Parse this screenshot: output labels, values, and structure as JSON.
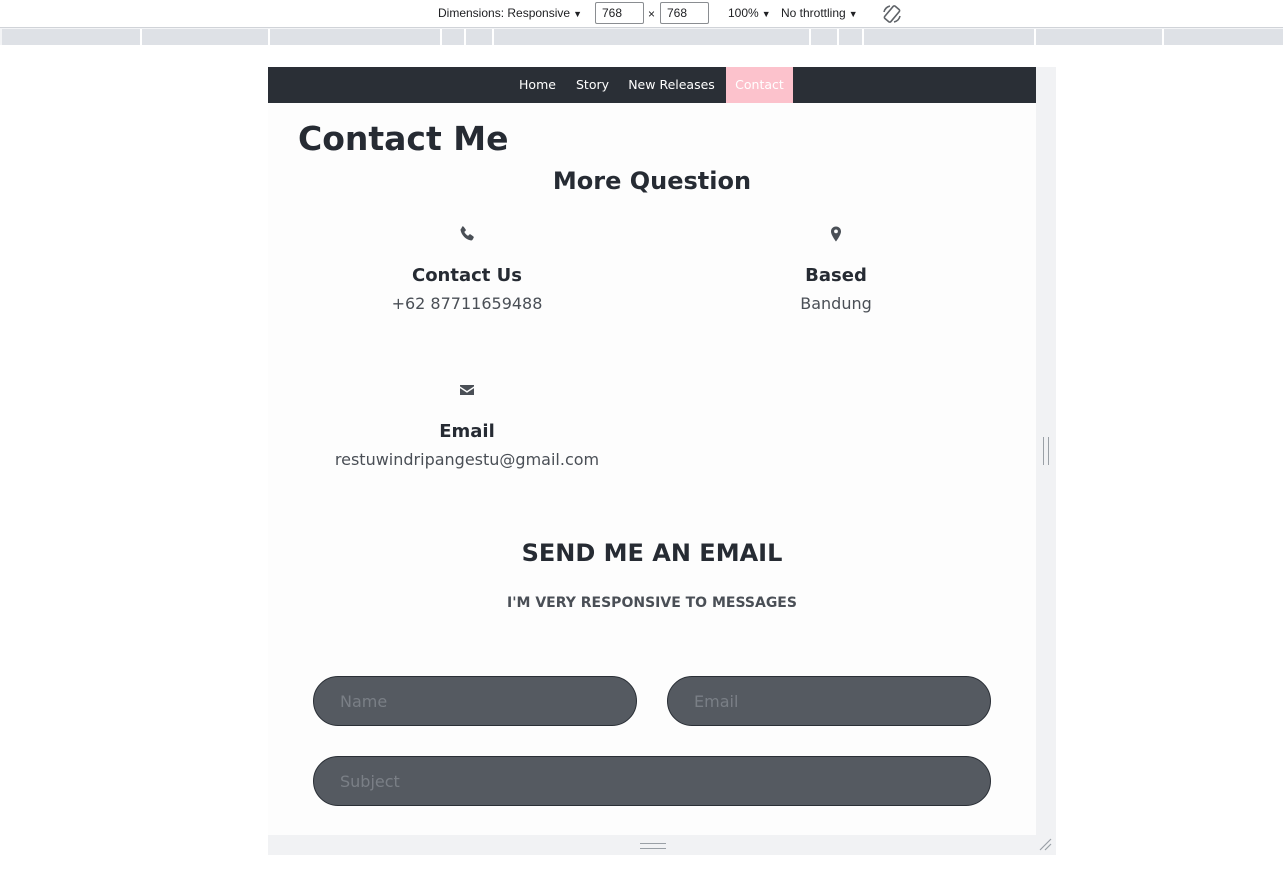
{
  "devtools": {
    "dimensions_label": "Dimensions: Responsive",
    "width_value": "768",
    "height_value": "768",
    "times": "×",
    "zoom": "100%",
    "throttling": "No throttling"
  },
  "nav": {
    "items": [
      {
        "label": "Home"
      },
      {
        "label": "Story"
      },
      {
        "label": "New Releases"
      },
      {
        "label": "Contact",
        "active": true
      }
    ]
  },
  "page": {
    "title": "Contact Me",
    "section_title": "More Question"
  },
  "info": [
    {
      "icon": "phone-icon",
      "heading": "Contact Us",
      "value": "+62 87711659488"
    },
    {
      "icon": "map-marker-icon",
      "heading": "Based",
      "value": "Bandung"
    },
    {
      "icon": "envelope-icon",
      "heading": "Email",
      "value": "restuwindripangestu@gmail.com"
    }
  ],
  "form": {
    "title": "SEND ME AN EMAIL",
    "subtitle": "I'M VERY RESPONSIVE TO MESSAGES",
    "name_placeholder": "Name",
    "email_placeholder": "Email",
    "subject_placeholder": "Subject"
  },
  "colors": {
    "nav_bg": "#2a2f36",
    "active_tab": "#fcc2cc",
    "field_bg": "#555a61",
    "text_dark": "#262b33"
  }
}
